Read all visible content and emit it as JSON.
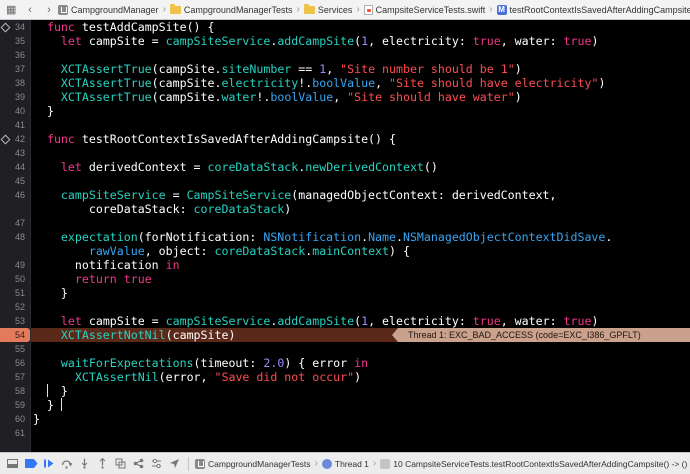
{
  "jumpbar": {
    "crumbs": [
      {
        "label": "CampgroundManager",
        "icon": "app-icon"
      },
      {
        "label": "CampgroundManagerTests",
        "icon": "folder-icon"
      },
      {
        "label": "Services",
        "icon": "folder-icon"
      },
      {
        "label": "CampsiteServiceTests.swift",
        "icon": "swift-file-icon"
      },
      {
        "label": "testRootContextIsSavedAfterAddingCampsite()",
        "icon": "method-icon"
      }
    ]
  },
  "editor": {
    "lines": [
      {
        "n": "34",
        "marker": "diamond",
        "segs": [
          [
            "pl",
            "  "
          ],
          [
            "kw",
            "func"
          ],
          [
            "pl",
            " testAddCampSite() {"
          ]
        ]
      },
      {
        "n": "35",
        "segs": [
          [
            "pl",
            "    "
          ],
          [
            "kw",
            "let"
          ],
          [
            "pl",
            " campSite = "
          ],
          [
            "fn",
            "campSiteService"
          ],
          [
            "pl",
            "."
          ],
          [
            "fn",
            "addCampSite"
          ],
          [
            "pl",
            "("
          ],
          [
            "num",
            "1"
          ],
          [
            "pl",
            ", electricity: "
          ],
          [
            "kw",
            "true"
          ],
          [
            "pl",
            ", water: "
          ],
          [
            "kw",
            "true"
          ],
          [
            "pl",
            ")"
          ]
        ]
      },
      {
        "n": "36",
        "segs": []
      },
      {
        "n": "37",
        "segs": [
          [
            "pl",
            "    "
          ],
          [
            "fn",
            "XCTAssertTrue"
          ],
          [
            "pl",
            "(campSite."
          ],
          [
            "fn",
            "siteNumber"
          ],
          [
            "pl",
            " == "
          ],
          [
            "num",
            "1"
          ],
          [
            "pl",
            ", "
          ],
          [
            "str",
            "\"Site number should be 1\""
          ],
          [
            "pl",
            ")"
          ]
        ]
      },
      {
        "n": "38",
        "segs": [
          [
            "pl",
            "    "
          ],
          [
            "fn",
            "XCTAssertTrue"
          ],
          [
            "pl",
            "(campSite."
          ],
          [
            "fn",
            "electricity"
          ],
          [
            "pl",
            "!."
          ],
          [
            "ty",
            "boolValue"
          ],
          [
            "pl",
            ", "
          ],
          [
            "str",
            "\"Site should have electricity\""
          ],
          [
            "pl",
            ")"
          ]
        ]
      },
      {
        "n": "39",
        "segs": [
          [
            "pl",
            "    "
          ],
          [
            "fn",
            "XCTAssertTrue"
          ],
          [
            "pl",
            "(campSite."
          ],
          [
            "fn",
            "water"
          ],
          [
            "pl",
            "!."
          ],
          [
            "ty",
            "boolValue"
          ],
          [
            "pl",
            ", "
          ],
          [
            "str",
            "\"Site should have water\""
          ],
          [
            "pl",
            ")"
          ]
        ]
      },
      {
        "n": "40",
        "segs": [
          [
            "pl",
            "  }"
          ]
        ]
      },
      {
        "n": "41",
        "segs": []
      },
      {
        "n": "42",
        "marker": "diamond",
        "segs": [
          [
            "pl",
            "  "
          ],
          [
            "kw",
            "func"
          ],
          [
            "pl",
            " testRootContextIsSavedAfterAddingCampsite() {"
          ]
        ]
      },
      {
        "n": "43",
        "segs": []
      },
      {
        "n": "44",
        "segs": [
          [
            "pl",
            "    "
          ],
          [
            "kw",
            "let"
          ],
          [
            "pl",
            " derivedContext = "
          ],
          [
            "fn",
            "coreDataStack"
          ],
          [
            "pl",
            "."
          ],
          [
            "fn",
            "newDerivedContext"
          ],
          [
            "pl",
            "()"
          ]
        ]
      },
      {
        "n": "45",
        "segs": []
      },
      {
        "n": "46",
        "segs": [
          [
            "pl",
            "    "
          ],
          [
            "fn",
            "campSiteService"
          ],
          [
            "pl",
            " = "
          ],
          [
            "fn",
            "CampSiteService"
          ],
          [
            "pl",
            "(managedObjectContext: derivedContext,"
          ]
        ]
      },
      {
        "n": "",
        "segs": [
          [
            "pl",
            "        coreDataStack: "
          ],
          [
            "fn",
            "coreDataStack"
          ],
          [
            "pl",
            ")"
          ]
        ]
      },
      {
        "n": "47",
        "segs": []
      },
      {
        "n": "48",
        "segs": [
          [
            "pl",
            "    "
          ],
          [
            "fn",
            "expectation"
          ],
          [
            "pl",
            "(forNotification: "
          ],
          [
            "ty",
            "NSNotification"
          ],
          [
            "pl",
            "."
          ],
          [
            "ty",
            "Name"
          ],
          [
            "pl",
            "."
          ],
          [
            "ty",
            "NSManagedObjectContextDidSave"
          ],
          [
            "pl",
            "."
          ]
        ]
      },
      {
        "n": "",
        "segs": [
          [
            "pl",
            "        "
          ],
          [
            "ty",
            "rawValue"
          ],
          [
            "pl",
            ", object: "
          ],
          [
            "fn",
            "coreDataStack"
          ],
          [
            "pl",
            "."
          ],
          [
            "fn",
            "mainContext"
          ],
          [
            "pl",
            ") {"
          ]
        ]
      },
      {
        "n": "49",
        "segs": [
          [
            "pl",
            "      notification "
          ],
          [
            "kw",
            "in"
          ]
        ]
      },
      {
        "n": "50",
        "segs": [
          [
            "pl",
            "      "
          ],
          [
            "kw",
            "return"
          ],
          [
            "pl",
            " "
          ],
          [
            "kw",
            "true"
          ]
        ]
      },
      {
        "n": "51",
        "segs": [
          [
            "pl",
            "    }"
          ]
        ]
      },
      {
        "n": "52",
        "segs": []
      },
      {
        "n": "53",
        "segs": [
          [
            "pl",
            "    "
          ],
          [
            "kw",
            "let"
          ],
          [
            "pl",
            " campSite = "
          ],
          [
            "fn",
            "campSiteService"
          ],
          [
            "pl",
            "."
          ],
          [
            "fn",
            "addCampSite"
          ],
          [
            "pl",
            "("
          ],
          [
            "num",
            "1"
          ],
          [
            "pl",
            ", electricity: "
          ],
          [
            "kw",
            "true"
          ],
          [
            "pl",
            ", water: "
          ],
          [
            "kw",
            "true"
          ],
          [
            "pl",
            ")"
          ]
        ]
      },
      {
        "n": "54",
        "highlight": true,
        "segs": [
          [
            "pl",
            "    "
          ],
          [
            "fn",
            "XCTAssertNotNil"
          ],
          [
            "pl",
            "(campSite)"
          ]
        ]
      },
      {
        "n": "55",
        "segs": []
      },
      {
        "n": "56",
        "segs": [
          [
            "pl",
            "    "
          ],
          [
            "fn",
            "waitForExpectations"
          ],
          [
            "pl",
            "(timeout: "
          ],
          [
            "num",
            "2.0"
          ],
          [
            "pl",
            ") { error "
          ],
          [
            "kw",
            "in"
          ]
        ]
      },
      {
        "n": "57",
        "segs": [
          [
            "pl",
            "      "
          ],
          [
            "fn",
            "XCTAssertNil"
          ],
          [
            "pl",
            "(error, "
          ],
          [
            "str",
            "\"Save did not occur\""
          ],
          [
            "pl",
            ")"
          ]
        ]
      },
      {
        "n": "58",
        "segs": [
          [
            "pl",
            "    }"
          ]
        ]
      },
      {
        "n": "59",
        "segs": [
          [
            "pl",
            "  }"
          ]
        ]
      },
      {
        "n": "60",
        "segs": [
          [
            "pl",
            "}"
          ]
        ]
      },
      {
        "n": "61",
        "segs": []
      }
    ],
    "exception_banner": "Thread 1: EXC_BAD_ACCESS (code=EXC_I386_GPFLT)"
  },
  "debugbar": {
    "target": "CampgroundManagerTests",
    "thread": "Thread 1",
    "frame": "10 CampsiteServiceTests.testRootContextIsSavedAfterAddingCampsite() -> ()"
  }
}
